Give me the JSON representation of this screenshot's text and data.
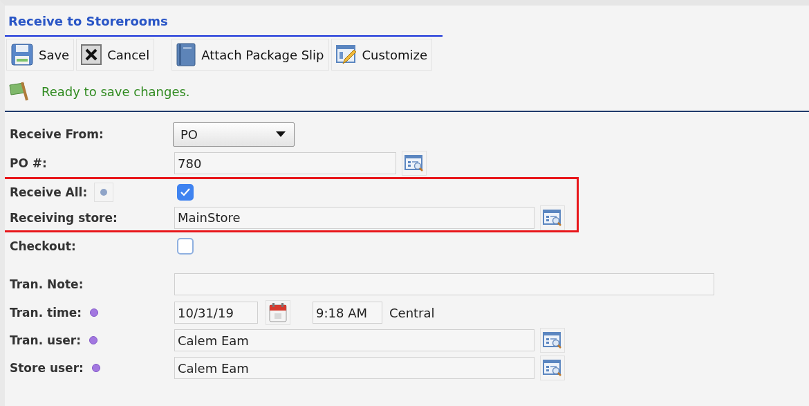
{
  "title": "Receive to Storerooms",
  "toolbar": [
    {
      "kind": "save",
      "label": "Save"
    },
    {
      "kind": "cancel",
      "label": "Cancel"
    },
    {
      "kind": "attach",
      "label": "Attach Package Slip"
    },
    {
      "kind": "customize",
      "label": "Customize"
    }
  ],
  "status": "Ready to save changes.",
  "fields": [
    {
      "label": "Receive From:",
      "kind": "select",
      "value": "PO",
      "highlighted": false
    },
    {
      "label": "PO #:",
      "kind": "short-lookup",
      "value": "780",
      "highlighted": false
    },
    {
      "label": "Receive All:",
      "kind": "checkbox",
      "checked": true,
      "info": true,
      "highlighted": true
    },
    {
      "label": "Receiving store:",
      "kind": "lookup",
      "value": "MainStore",
      "highlighted": true
    },
    {
      "label": "Checkout:",
      "kind": "checkbox",
      "checked": false,
      "highlighted": false
    },
    {
      "label": "Tran. Note:",
      "kind": "text",
      "highlighted": false
    },
    {
      "label": "Tran. time:",
      "kind": "datetime",
      "required": true,
      "date": "10/31/19",
      "time": "9:18 AM",
      "zone": "Central",
      "highlighted": false
    },
    {
      "label": "Tran. user:",
      "kind": "lookup",
      "required": true,
      "value": "Calem Eam",
      "highlighted": false
    },
    {
      "label": "Store user:",
      "kind": "lookup",
      "required": true,
      "value": "Calem Eam",
      "highlighted": false
    }
  ]
}
